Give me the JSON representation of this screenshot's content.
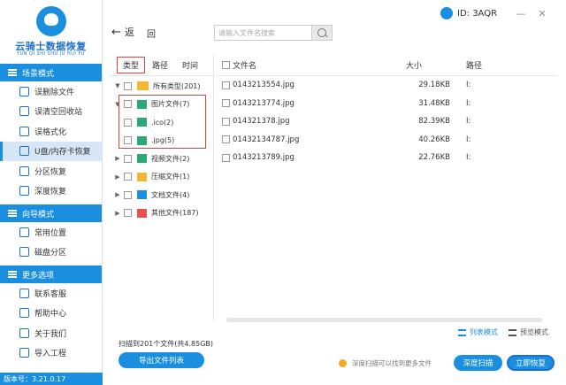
{
  "app": {
    "logo_title": "云骑士数据恢复",
    "logo_sub": "YUN QI SHI SHU JU HUI FU",
    "version": "版本号：3.21.0.17",
    "id_label": "ID: 3AQR",
    "min_glyph": "—",
    "close_glyph": "✕"
  },
  "sidebar": {
    "sections": [
      {
        "title": "场景模式",
        "items": [
          {
            "label": "误删除文件",
            "active": false
          },
          {
            "label": "误清空回收站",
            "active": false
          },
          {
            "label": "误格式化",
            "active": false
          },
          {
            "label": "U盘/内存卡恢复",
            "active": true
          },
          {
            "label": "分区恢复",
            "active": false
          },
          {
            "label": "深度恢复",
            "active": false
          }
        ]
      },
      {
        "title": "向导模式",
        "items": [
          {
            "label": "常用位置",
            "active": false
          },
          {
            "label": "磁盘分区",
            "active": false
          }
        ]
      },
      {
        "title": "更多选项",
        "items": [
          {
            "label": "联系客服",
            "active": false
          },
          {
            "label": "帮助中心",
            "active": false
          },
          {
            "label": "关于我们",
            "active": false
          },
          {
            "label": "导入工程",
            "active": false
          }
        ]
      }
    ]
  },
  "nav": {
    "back_arrow": "←",
    "back_label": "返",
    "up_label": "回",
    "search_placeholder": "请输入文件名搜索"
  },
  "tree": {
    "tabs": [
      "类型",
      "路径",
      "时间"
    ],
    "rows": [
      {
        "label": "所有类型(201)",
        "indent": 0,
        "tri": "▼",
        "icon": "folder-icon",
        "color": "#f5b731"
      },
      {
        "label": "图片文件(7)",
        "indent": 1,
        "tri": "▼",
        "icon": "image-icon",
        "color": "#2aa876"
      },
      {
        "label": ".ico(2)",
        "indent": 2,
        "tri": "",
        "icon": "image-icon",
        "color": "#2aa876"
      },
      {
        "label": ".jpg(5)",
        "indent": 2,
        "tri": "",
        "icon": "image-icon",
        "color": "#2aa876"
      },
      {
        "label": "视频文件(2)",
        "indent": 1,
        "tri": "▶",
        "icon": "video-icon",
        "color": "#2aa876"
      },
      {
        "label": "压缩文件(1)",
        "indent": 1,
        "tri": "▶",
        "icon": "archive-icon",
        "color": "#f5b731"
      },
      {
        "label": "文档文件(4)",
        "indent": 1,
        "tri": "▶",
        "icon": "document-icon",
        "color": "#1a8fe0"
      },
      {
        "label": "其他文件(187)",
        "indent": 1,
        "tri": "▶",
        "icon": "other-icon",
        "color": "#e5534b"
      }
    ]
  },
  "files": {
    "columns": {
      "name": "文件名",
      "size": "大小",
      "path": "路径"
    },
    "rows": [
      {
        "name": "0143213554.jpg",
        "size": "29.18KB",
        "path": "I:"
      },
      {
        "name": "0143213774.jpg",
        "size": "31.48KB",
        "path": "I:"
      },
      {
        "name": "014321378.jpg",
        "size": "82.39KB",
        "path": "I:"
      },
      {
        "name": "0143213478​7.jpg",
        "size": "40.26KB",
        "path": "I:"
      },
      {
        "name": "0143213789.jpg",
        "size": "22.76KB",
        "path": "I:"
      }
    ]
  },
  "views": {
    "list_label": "列表模式",
    "preview_label": "预览模式"
  },
  "footer": {
    "scan_summary": "扫描到201个文件(共4.85GB)",
    "export_label": "导出文件列表",
    "deep_hint": "深度扫描可以找到更多文件",
    "deep_scan_label": "深度扫描",
    "recover_label": "立即恢复"
  },
  "colors": {
    "accent": "#1a8fe0",
    "highlight_border": "#e04040"
  }
}
